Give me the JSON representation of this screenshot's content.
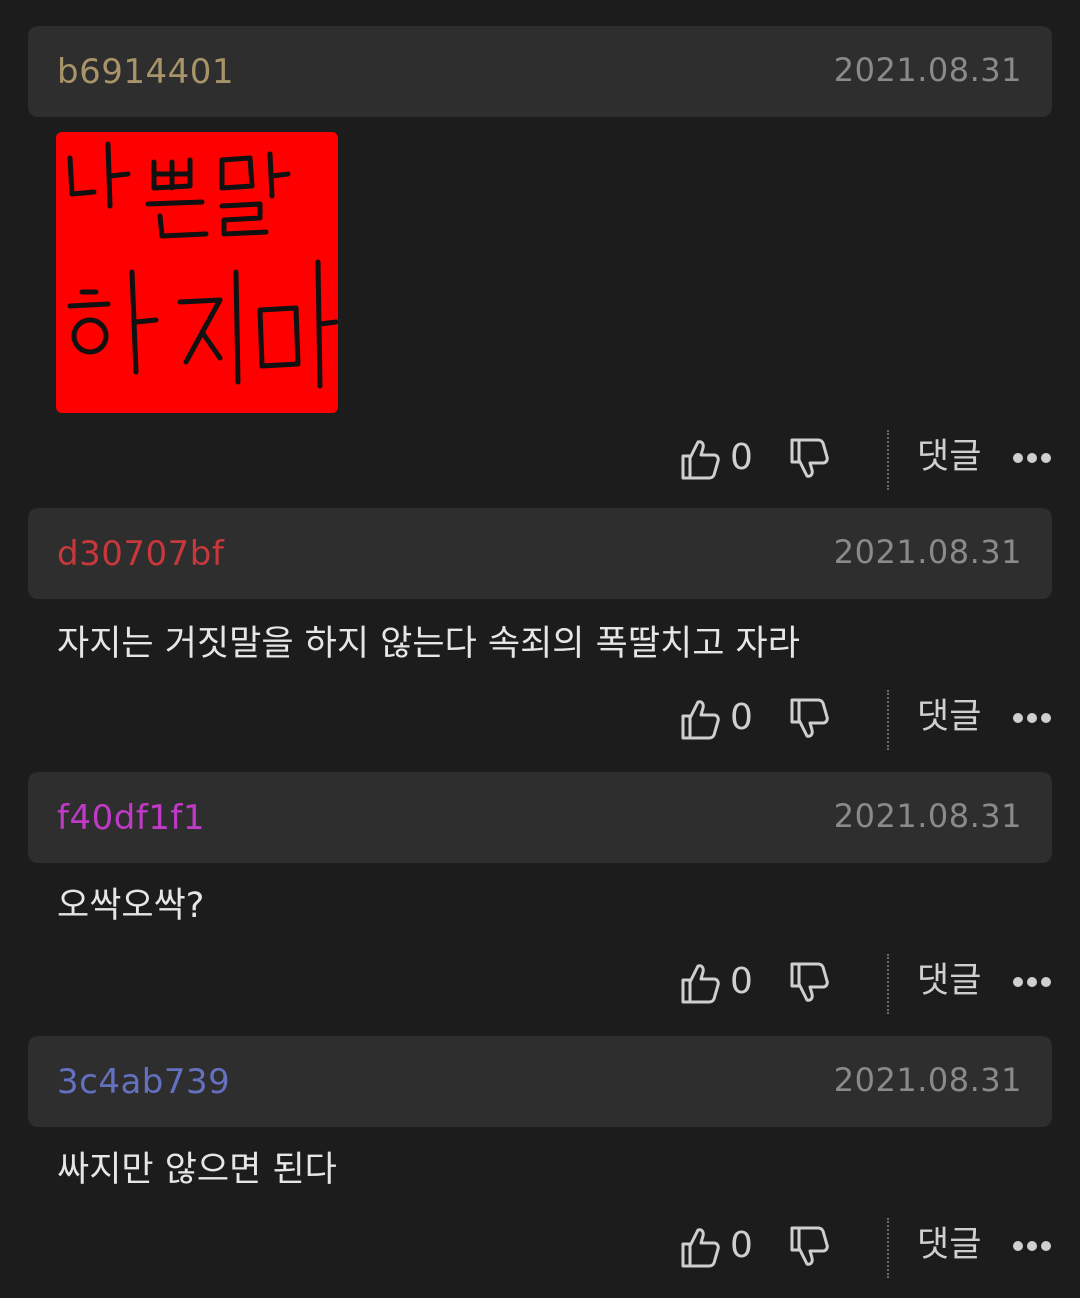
{
  "comments": [
    {
      "user": "b6914401",
      "user_color": "#a89468",
      "date": "2021.08.31",
      "text": "",
      "image_text": "나쁜말 하지마",
      "likes": "0",
      "reply_label": "댓글"
    },
    {
      "user": "d30707bf",
      "user_color": "#c8383a",
      "date": "2021.08.31",
      "text": "자지는 거짓말을 하지 않는다 속죄의 폭딸치고 자라",
      "likes": "0",
      "reply_label": "댓글"
    },
    {
      "user": "f40df1f1",
      "user_color": "#c03ac8",
      "date": "2021.08.31",
      "text": "오싹오싹?",
      "likes": "0",
      "reply_label": "댓글"
    },
    {
      "user": "3c4ab739",
      "user_color": "#6470c0",
      "date": "2021.08.31",
      "text": "싸지만 않으면 된다",
      "likes": "0",
      "reply_label": "댓글"
    }
  ],
  "icons": {
    "like": "thumbs-up-icon",
    "dislike": "thumbs-down-icon",
    "more": "more-dots-icon"
  }
}
